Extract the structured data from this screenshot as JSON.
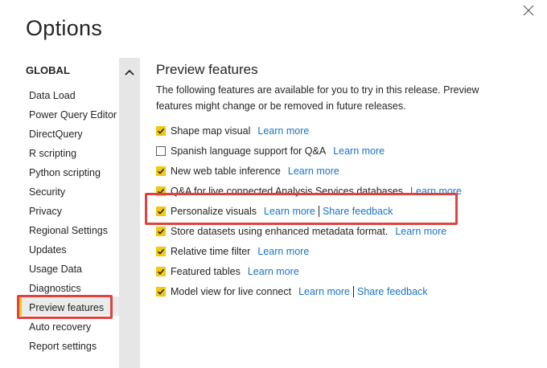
{
  "dialog": {
    "title": "Options",
    "close_icon": "close-icon"
  },
  "nav": {
    "heading": "GLOBAL",
    "items": [
      {
        "label": "Data Load"
      },
      {
        "label": "Power Query Editor"
      },
      {
        "label": "DirectQuery"
      },
      {
        "label": "R scripting"
      },
      {
        "label": "Python scripting"
      },
      {
        "label": "Security"
      },
      {
        "label": "Privacy"
      },
      {
        "label": "Regional Settings"
      },
      {
        "label": "Updates"
      },
      {
        "label": "Usage Data"
      },
      {
        "label": "Diagnostics"
      },
      {
        "label": "Preview features",
        "selected": true
      },
      {
        "label": "Auto recovery"
      },
      {
        "label": "Report settings"
      }
    ],
    "scroll_icon": "chevron-up-icon"
  },
  "content": {
    "title": "Preview features",
    "description": "The following features are available for you to try in this release. Preview features might change or be removed in future releases.",
    "features": [
      {
        "label": "Shape map visual",
        "checked": true,
        "link1": "Learn more"
      },
      {
        "label": "Spanish language support for Q&A",
        "checked": false,
        "link1": "Learn more"
      },
      {
        "label": "New web table inference",
        "checked": true,
        "link1": "Learn more"
      },
      {
        "label": "Q&A for live connected Analysis Services databases",
        "checked": true,
        "link1": "Learn more"
      },
      {
        "label": "Personalize visuals",
        "checked": true,
        "link1": "Learn more",
        "link2": "Share feedback"
      },
      {
        "label": "Store datasets using enhanced metadata format.",
        "checked": true,
        "link1": "Learn more"
      },
      {
        "label": "Relative time filter",
        "checked": true,
        "link1": "Learn more"
      },
      {
        "label": "Featured tables",
        "checked": true,
        "link1": "Learn more"
      },
      {
        "label": "Model view for live connect",
        "checked": true,
        "link1": "Learn more",
        "link2": "Share feedback"
      }
    ]
  },
  "colors": {
    "accent": "#f2c811",
    "link": "#1a73c9",
    "highlight": "#e0433f"
  }
}
